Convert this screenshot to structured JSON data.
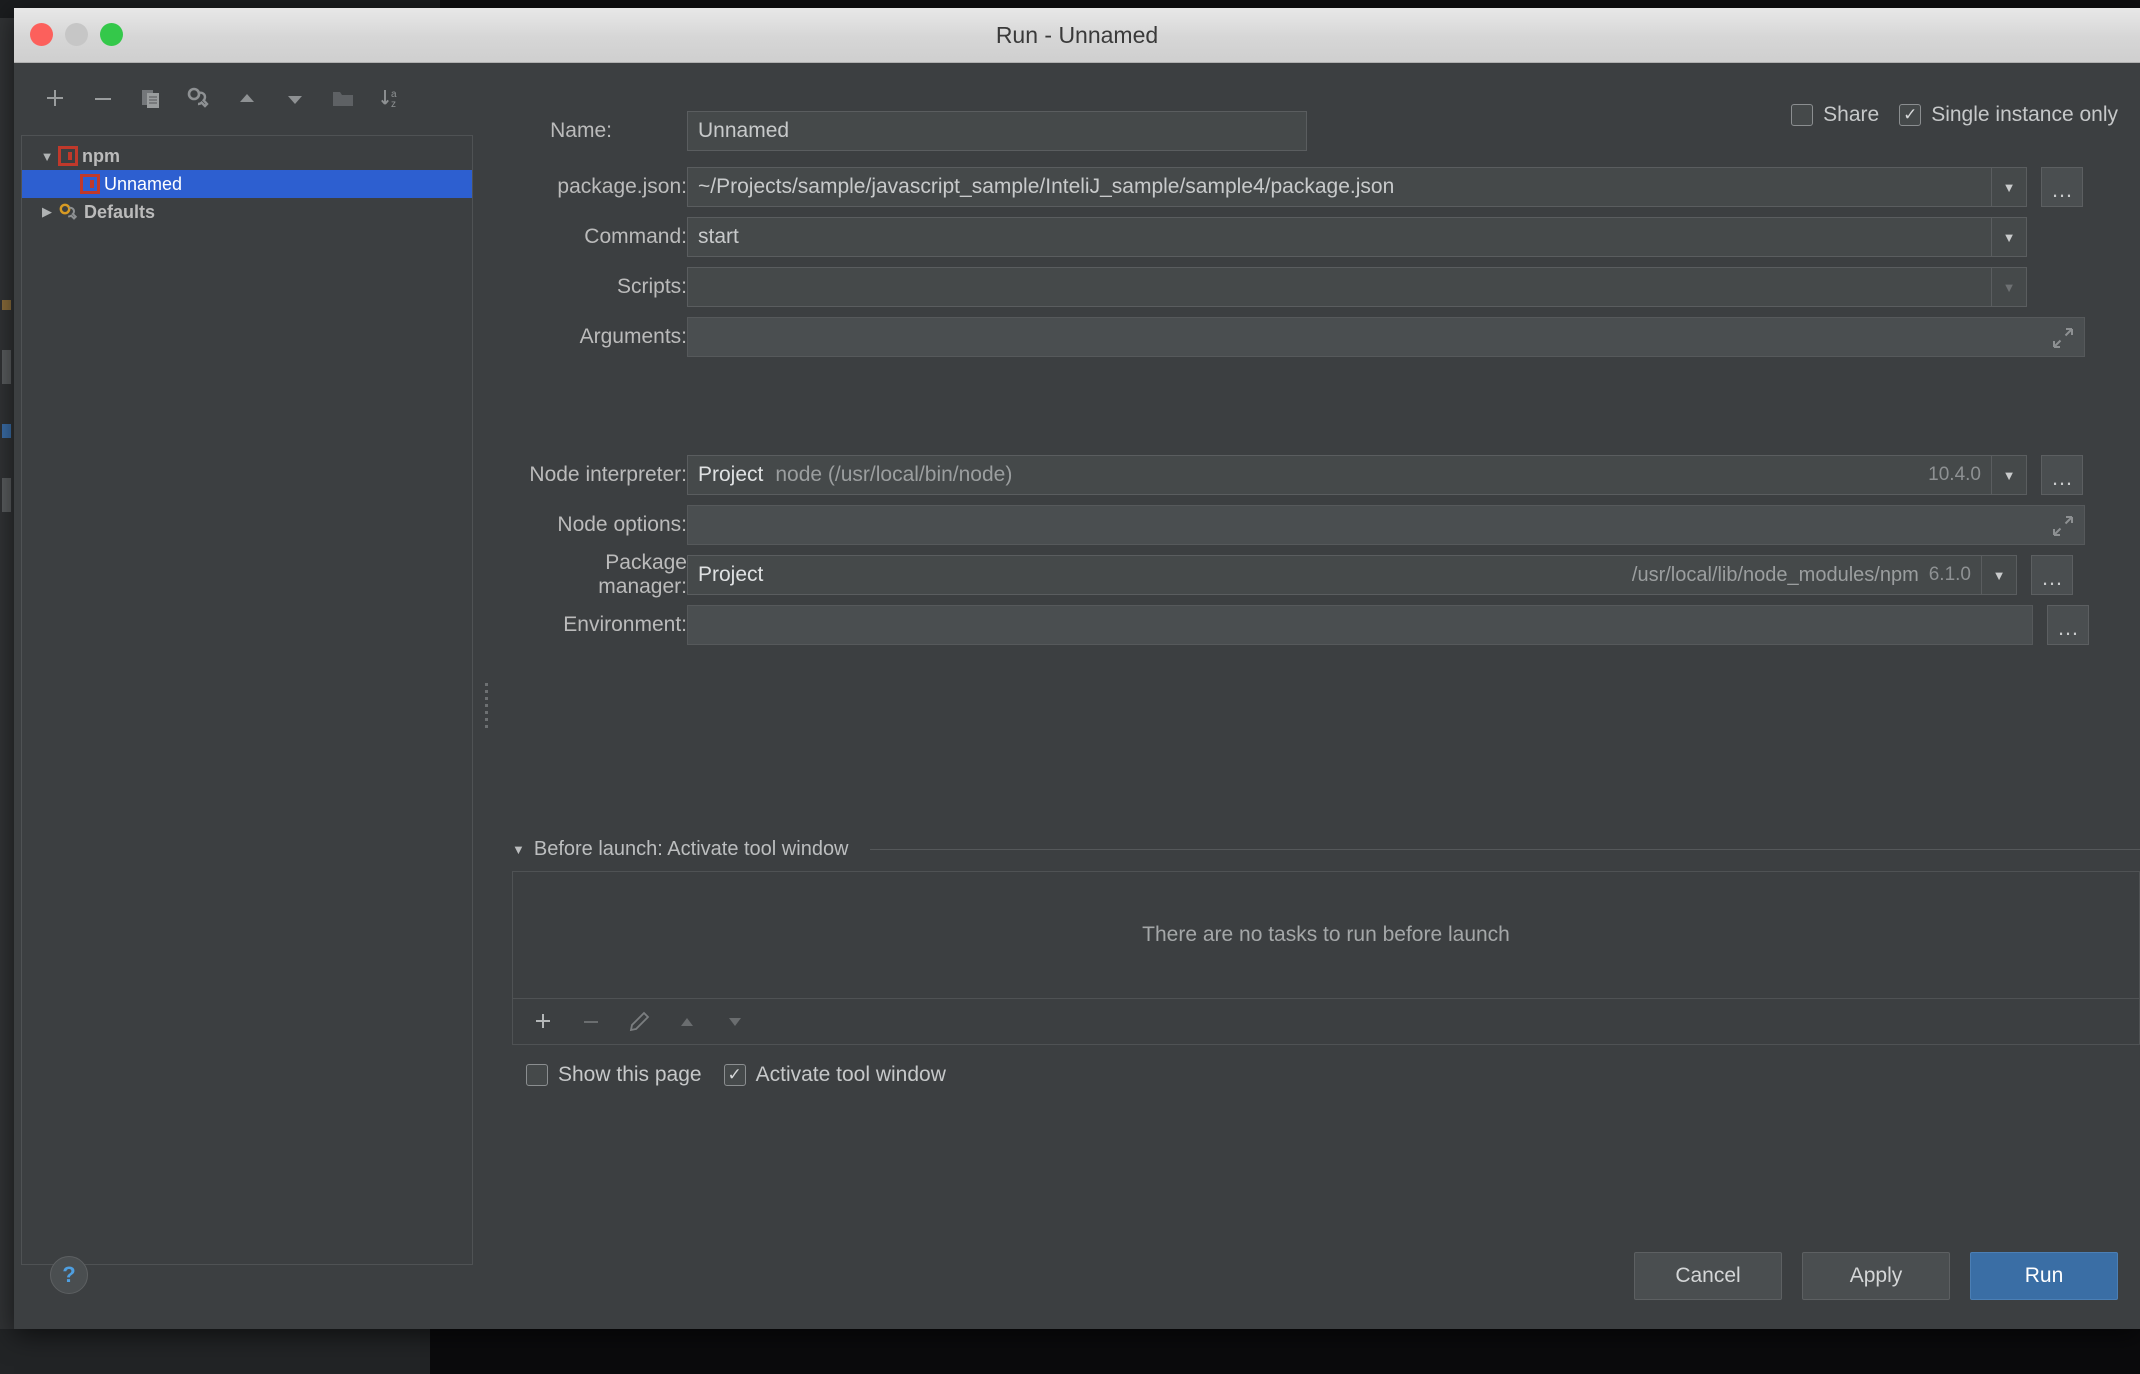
{
  "window": {
    "title": "Run - Unnamed",
    "traffic": [
      "close-button",
      "minimize-button",
      "zoom-button"
    ]
  },
  "tree_toolbar": [
    {
      "name": "add-button",
      "glyph": "+"
    },
    {
      "name": "remove-button",
      "glyph": "−"
    },
    {
      "name": "copy-button",
      "glyph": "copy-icon"
    },
    {
      "name": "edit-templates-button",
      "glyph": "wrench-icon"
    },
    {
      "name": "move-up-button",
      "glyph": "▲"
    },
    {
      "name": "move-down-button",
      "glyph": "▼"
    },
    {
      "name": "folder-button",
      "glyph": "folder-icon"
    },
    {
      "name": "sort-button",
      "glyph": "sort-az-icon"
    }
  ],
  "tree": {
    "items": [
      {
        "label": "npm",
        "arrow": "▼",
        "icon": "npm-icon",
        "indent": 0,
        "selected": false,
        "bold": true
      },
      {
        "label": "Unnamed",
        "arrow": "",
        "icon": "npm-icon",
        "indent": 1,
        "selected": true,
        "bold": false
      },
      {
        "label": "Defaults",
        "arrow": "▶",
        "icon": "wrench-icon",
        "indent": 0,
        "selected": false,
        "bold": true
      }
    ]
  },
  "header": {
    "name_label": "Name:",
    "name_value": "Unnamed",
    "share_label": "Share",
    "share_checked": false,
    "single_instance_label": "Single instance only",
    "single_instance_checked": true,
    "check_glyph": "✓"
  },
  "fields": {
    "package_json_label": "package.json:",
    "package_json_value": "~/Projects/sample/javascript_sample/InteliJ_sample/sample4/package.json",
    "command_label": "Command:",
    "command_value": "start",
    "scripts_label": "Scripts:",
    "scripts_value": "",
    "arguments_label": "Arguments:",
    "arguments_value": "",
    "node_interpreter_label": "Node interpreter:",
    "node_interpreter_scope": "Project",
    "node_interpreter_value": "node (/usr/local/bin/node)",
    "node_interpreter_version": "10.4.0",
    "node_options_label": "Node options:",
    "node_options_value": "",
    "package_manager_label": "Package manager:",
    "package_manager_scope": "Project",
    "package_manager_path": "/usr/local/lib/node_modules/npm",
    "package_manager_version": "6.1.0",
    "environment_label": "Environment:",
    "environment_value": "",
    "dropdown_glyph": "▼",
    "ellipsis_glyph": "…"
  },
  "before_launch": {
    "title": "Before launch: Activate tool window",
    "collapse_glyph": "▼",
    "empty_message": "There are no tasks to run before launch",
    "toolbar": [
      {
        "name": "add-task-button",
        "glyph": "+",
        "enabled": true
      },
      {
        "name": "remove-task-button",
        "glyph": "−",
        "enabled": false
      },
      {
        "name": "edit-task-button",
        "glyph": "pencil-icon",
        "enabled": false
      },
      {
        "name": "move-task-up-button",
        "glyph": "▲",
        "enabled": false
      },
      {
        "name": "move-task-down-button",
        "glyph": "▼",
        "enabled": false
      }
    ]
  },
  "bottom_options": {
    "show_page_label": "Show this page",
    "show_page_checked": false,
    "activate_tool_window_label": "Activate tool window",
    "activate_tool_window_checked": true
  },
  "footer": {
    "help_glyph": "?",
    "cancel_label": "Cancel",
    "apply_label": "Apply",
    "run_label": "Run"
  },
  "colors": {
    "dialog_bg": "#3c3f41",
    "field_bg": "#45494a",
    "selection_blue": "#2d5fd0",
    "primary_button": "#3a6ea5",
    "npm_red": "#c0392b",
    "help_blue": "#4f9fe0"
  }
}
